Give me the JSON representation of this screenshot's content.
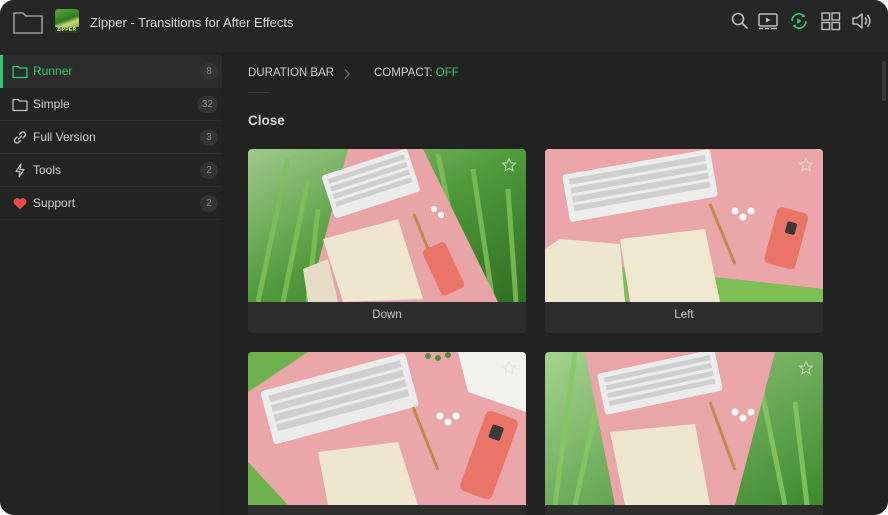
{
  "app": {
    "title": "Zipper - Transitions for After Effects",
    "thumb_text": "ZIPPER"
  },
  "header_icons": [
    "search-icon",
    "preview-panel-icon",
    "refresh-play-icon",
    "grid-view-icon",
    "volume-icon"
  ],
  "colors": {
    "accent": "#2ecc71",
    "background": "#232323",
    "heart": "#e84a4a"
  },
  "sidebar": {
    "items": [
      {
        "label": "Runner",
        "count": "8",
        "icon": "folder-icon",
        "active": true
      },
      {
        "label": "Simple",
        "count": "32",
        "icon": "folder-icon",
        "active": false
      },
      {
        "label": "Full Version",
        "count": "3",
        "icon": "link-icon",
        "active": false
      },
      {
        "label": "Tools",
        "count": "2",
        "icon": "lightning-icon",
        "active": false
      },
      {
        "label": "Support",
        "count": "2",
        "icon": "heart-icon",
        "active": false
      }
    ]
  },
  "toolbar": {
    "duration_label": "DURATION BAR",
    "compact_label": "COMPACT:",
    "compact_value": "OFF"
  },
  "section": {
    "title": "Close"
  },
  "cards": [
    {
      "label": "Down"
    },
    {
      "label": "Left"
    },
    {
      "label": ""
    },
    {
      "label": ""
    }
  ]
}
